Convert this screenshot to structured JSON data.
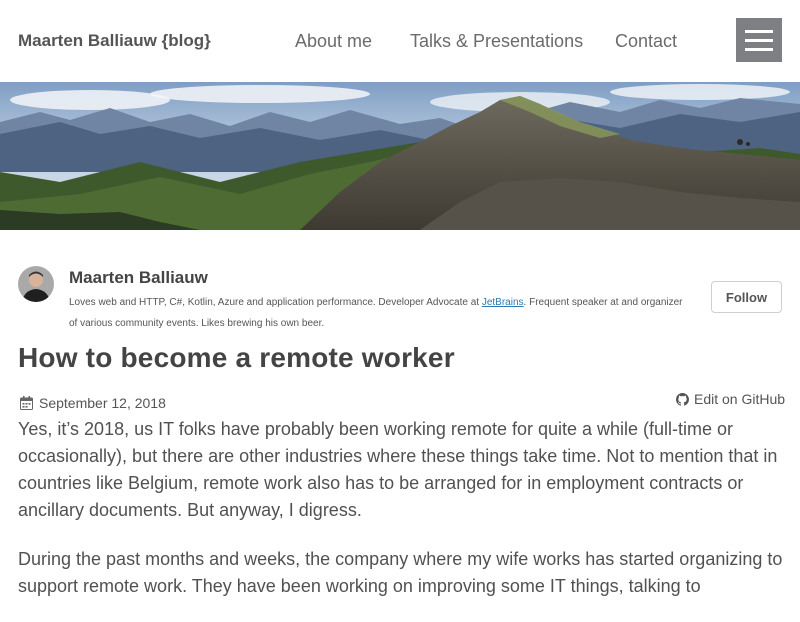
{
  "site": {
    "brand": "Maarten Balliauw {blog}"
  },
  "nav": {
    "items": [
      "About me",
      "Talks & Presentations",
      "Contact"
    ]
  },
  "author": {
    "name": "Maarten Balliauw",
    "bio_prefix": "Loves web and HTTP, C#, Kotlin, Azure and application performance. Developer Advocate at ",
    "bio_link": "JetBrains",
    "bio_suffix": ". Frequent speaker at and organizer of various community events. Likes brewing his own beer.",
    "follow_label": "Follow"
  },
  "post": {
    "title": "How to become a remote worker",
    "date": "September 12, 2018",
    "edit_label": "Edit on GitHub",
    "paragraphs": [
      "Yes, it’s 2018, us IT folks have probably been working remote for quite a while (full-time or occasionally), but there are other industries where these things take time. Not to mention that in countries like Belgium, remote work also has to be arranged for in employment contracts or ancillary documents. But anyway, I digress.",
      "During the past months and weeks, the company where my wife works has started organizing to support remote work. They have been working on improving some IT things, talking to"
    ]
  },
  "icons": {
    "menu": "hamburger-menu-icon",
    "calendar": "calendar-icon",
    "github": "github-icon"
  },
  "colors": {
    "menu_button": "#7d7f82",
    "link": "#2a7ab0",
    "text": "#515151"
  }
}
